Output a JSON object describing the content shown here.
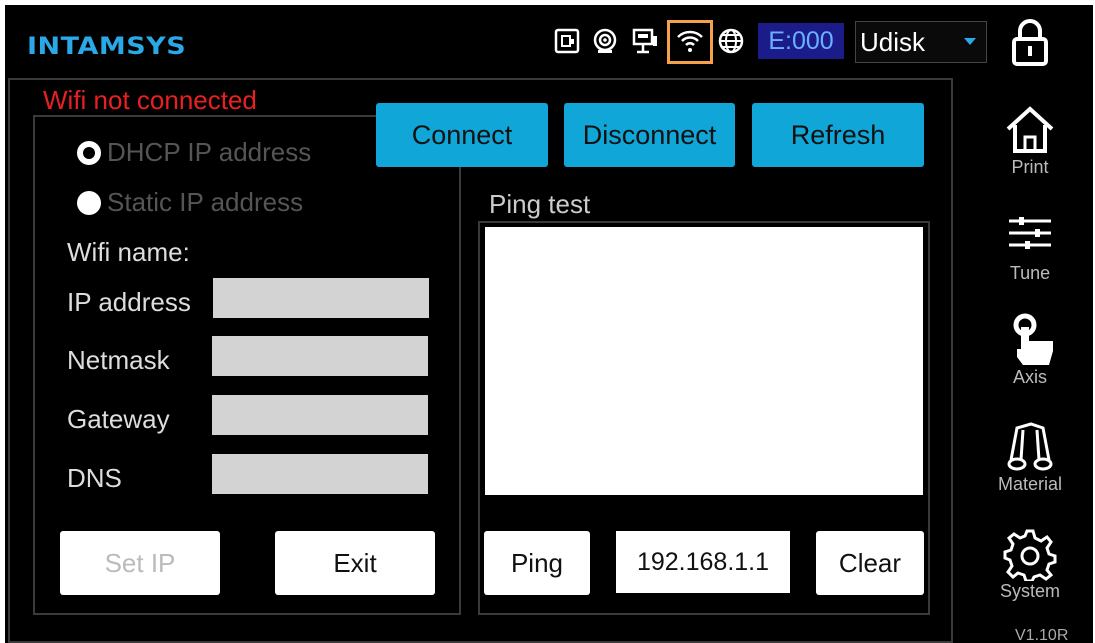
{
  "header": {
    "logo": "INTAMSYS",
    "icons": [
      "usb-drive-icon",
      "webcam-icon",
      "ethernet-icon",
      "wifi-icon",
      "globe-icon"
    ],
    "error_code": "E:000",
    "storage_select": "Udisk",
    "lock_icon": "lock-icon"
  },
  "status": {
    "text": "Wifi not connected",
    "color": "#e82020"
  },
  "network": {
    "dhcp_label": "DHCP IP address",
    "static_label": "Static IP address",
    "wifi_name_label": "Wifi name:",
    "fields": [
      {
        "label": "IP address",
        "value": ""
      },
      {
        "label": "Netmask",
        "value": ""
      },
      {
        "label": "Gateway",
        "value": ""
      },
      {
        "label": "DNS",
        "value": ""
      }
    ],
    "set_ip_label": "Set IP",
    "exit_label": "Exit"
  },
  "actions": {
    "connect_label": "Connect",
    "disconnect_label": "Disconnect",
    "refresh_label": "Refresh"
  },
  "ping": {
    "title": "Ping test",
    "output": "",
    "ping_label": "Ping",
    "address": "192.168.1.1",
    "clear_label": "Clear"
  },
  "sidebar": {
    "items": [
      {
        "label": "Print",
        "icon": "home-icon"
      },
      {
        "label": "Tune",
        "icon": "sliders-icon"
      },
      {
        "label": "Axis",
        "icon": "hand-pointer-icon"
      },
      {
        "label": "Material",
        "icon": "filament-spool-icon"
      },
      {
        "label": "System",
        "icon": "gear-icon"
      }
    ],
    "version": "V1.10R"
  },
  "colors": {
    "accent": "#11a6d8",
    "logo": "#2aa8e8",
    "highlight": "#f5a04a",
    "background": "#000000"
  }
}
